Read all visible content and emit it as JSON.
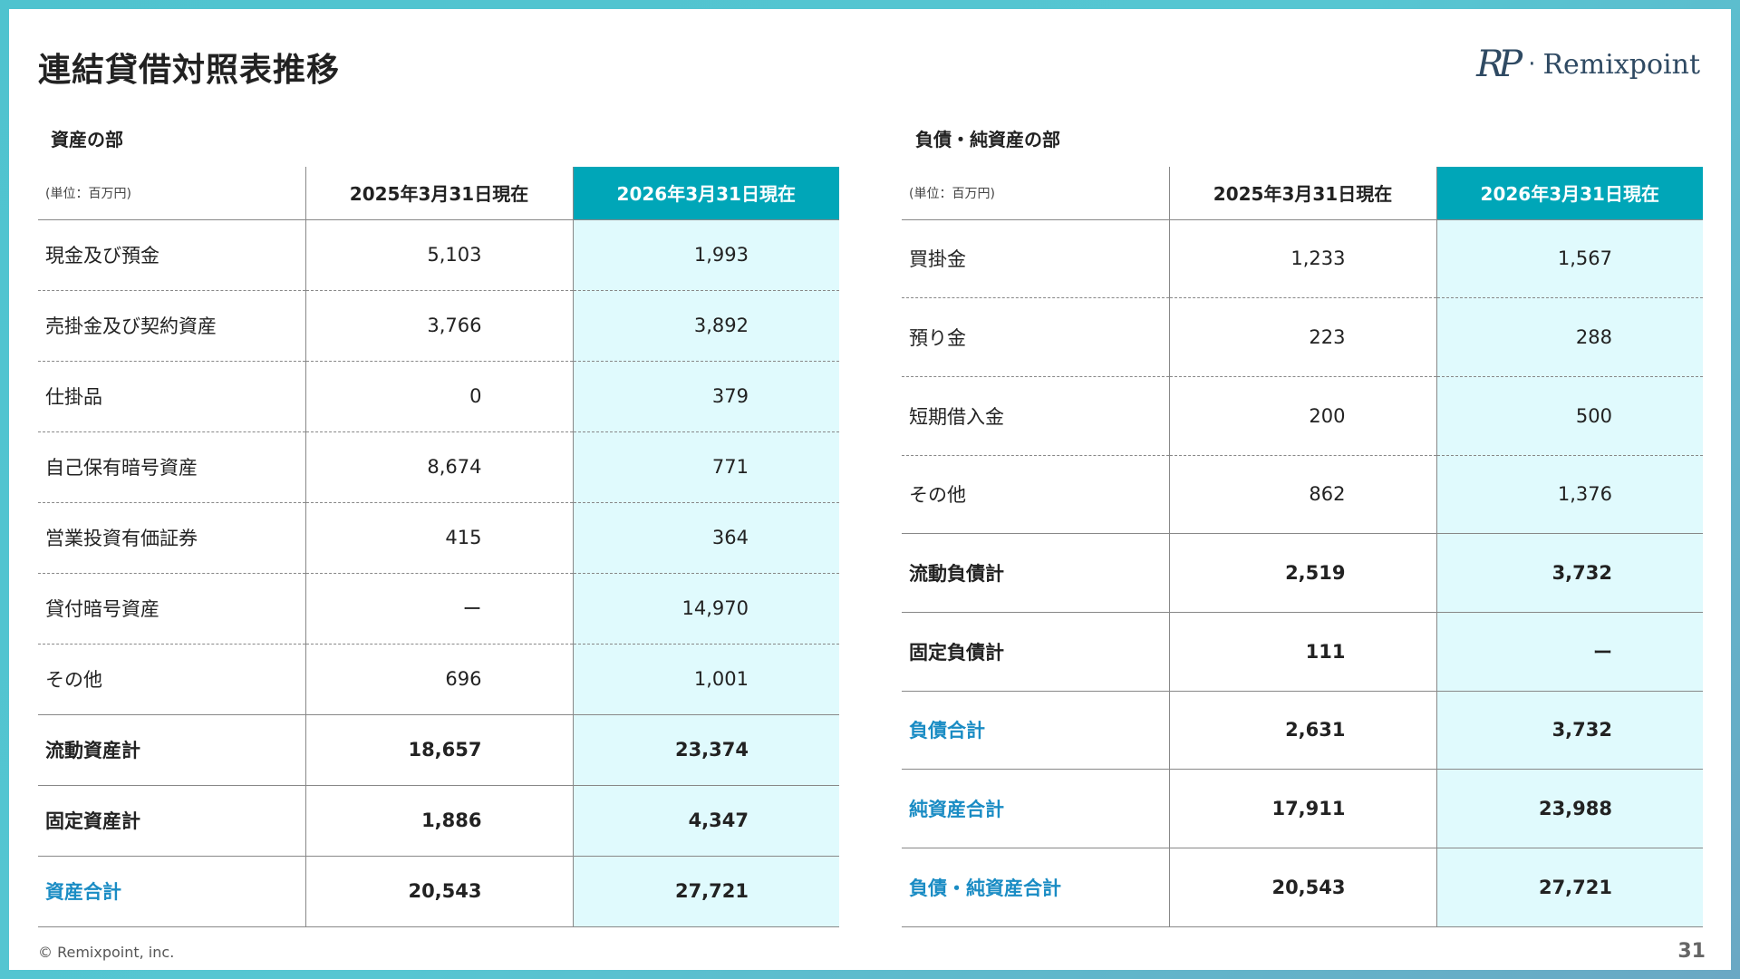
{
  "title": "連結貸借対照表推移",
  "logo": {
    "mark": "RP",
    "dot": "·",
    "text": "Remixpoint"
  },
  "footer": {
    "copyright": "© Remixpoint, inc.",
    "page_number": "31"
  },
  "colors": {
    "header_accent": "#00a6b8",
    "current_col_bg": "#e0fafd",
    "total_label": "#1a8cc4"
  },
  "assets": {
    "section_title": "資産の部",
    "unit": "(単位：百万円)",
    "col_prev": "2025年3月31日現在",
    "col_cur": "2026年3月31日現在",
    "rows": [
      {
        "label": "現金及び預金",
        "prev": "5,103",
        "cur": "1,993",
        "style": "dashed"
      },
      {
        "label": "売掛金及び契約資産",
        "prev": "3,766",
        "cur": "3,892",
        "style": "dashed"
      },
      {
        "label": "仕掛品",
        "prev": "0",
        "cur": "379",
        "style": "dashed"
      },
      {
        "label": "自己保有暗号資産",
        "prev": "8,674",
        "cur": "771",
        "style": "dashed"
      },
      {
        "label": "営業投資有価証券",
        "prev": "415",
        "cur": "364",
        "style": "dashed"
      },
      {
        "label": "貸付暗号資産",
        "prev": "ー",
        "cur": "14,970",
        "style": "dashed"
      },
      {
        "label": "その他",
        "prev": "696",
        "cur": "1,001",
        "style": "solid"
      },
      {
        "label": "流動資産計",
        "prev": "18,657",
        "cur": "23,374",
        "style": "solid bold"
      },
      {
        "label": "固定資産計",
        "prev": "1,886",
        "cur": "4,347",
        "style": "solid bold"
      },
      {
        "label": "資産合計",
        "prev": "20,543",
        "cur": "27,721",
        "style": "solid accent"
      }
    ]
  },
  "liabilities": {
    "section_title": "負債・純資産の部",
    "unit": "(単位：百万円)",
    "col_prev": "2025年3月31日現在",
    "col_cur": "2026年3月31日現在",
    "rows": [
      {
        "label": "買掛金",
        "prev": "1,233",
        "cur": "1,567",
        "style": "dashed"
      },
      {
        "label": "預り金",
        "prev": "223",
        "cur": "288",
        "style": "dashed"
      },
      {
        "label": "短期借入金",
        "prev": "200",
        "cur": "500",
        "style": "dashed"
      },
      {
        "label": "その他",
        "prev": "862",
        "cur": "1,376",
        "style": "solid"
      },
      {
        "label": "流動負債計",
        "prev": "2,519",
        "cur": "3,732",
        "style": "solid bold"
      },
      {
        "label": "固定負債計",
        "prev": "111",
        "cur": "ー",
        "style": "solid bold"
      },
      {
        "label": "負債合計",
        "prev": "2,631",
        "cur": "3,732",
        "style": "solid accent"
      },
      {
        "label": "純資産合計",
        "prev": "17,911",
        "cur": "23,988",
        "style": "solid accent"
      },
      {
        "label": "負債・純資産合計",
        "prev": "20,543",
        "cur": "27,721",
        "style": "solid accent"
      }
    ]
  }
}
